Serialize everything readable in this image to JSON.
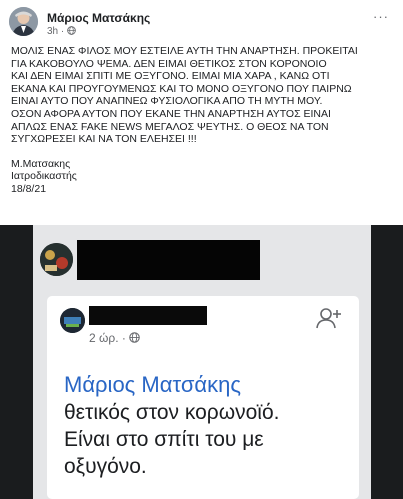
{
  "post": {
    "author": "Μάριος Ματσάκης",
    "time": "3h",
    "privacy_icon": "globe-icon",
    "menu_label": "···",
    "body_lines": [
      "ΜΟΛΙΣ ΕΝΑΣ ΦΙΛΟΣ ΜΟΥ ΕΣΤΕΙΛΕ ΑΥΤΗ ΤΗΝ ΑΝΑΡΤΗΣΗ.  ΠΡΟΚΕΙΤΑΙ",
      "ΓΙΑ ΚΑΚΟΒΟΥΛΟ ΨΕΜΑ. ΔΕΝ ΕΙΜΑΙ ΘΕΤΙΚΟΣ ΣΤΟΝ ΚΟΡΟΝΟΙΟ",
      "ΚΑΙ ΔΕΝ ΕΙΜΑΙ ΣΠΙΤΙ ΜΕ ΟΞΥΓΟΝΟ.  ΕΙΜΑΙ ΜΙΑ ΧΑΡΑ , ΚΑΝΩ ΟΤΙ",
      "ΕΚΑΝΑ ΚΑΙ ΠΡΟΥΓΟΥΜΕΝΩΣ ΚΑΙ ΤΟ ΜΟΝΟ ΟΞΥΓΟΝΟ ΠΟΥ ΠΑΙΡΝΩ",
      "ΕΙΝΑΙ ΑΥΤΟ ΠΟΥ ΑΝΑΠΝΕΩ ΦΥΣΙΟΛΟΓΙΚΑ ΑΠΟ ΤΗ ΜΥΤΗ ΜΟΥ.",
      "ΟΣΟΝ ΑΦΟΡΑ ΑΥΤΟΝ ΠΟΥ ΕΚΑΝΕ ΤΗΝ ΑΝΑΡΤΗΣΗ ΑΥΤΟΣ ΕΙΝΑΙ",
      "ΑΠΛΩΣ ΕΝΑΣ FAKE NEWS ΜΕΓΑΛΟΣ ΨΕΥΤΗΣ. Ο ΘΕΟΣ ΝΑ ΤΟΝ",
      "ΣΥΓΧΩΡΕΣΕΙ ΚΑΙ ΝΑ ΤΟΝ ΕΛΕΗΣΕΙ !!!"
    ],
    "signature": "Μ.Ματσακης",
    "title": "Ιατροδικαστής",
    "date": "18/8/21"
  },
  "shared_image": {
    "card_time": "2 ώρ. ·",
    "card_time_icon": "globe-icon",
    "add_friend_icon": "add-friend-icon",
    "name": "Μάριος Ματσάκης",
    "text_lines": [
      "θετικός στον κορωνοϊό.",
      "Είναι στο σπίτι του με",
      "οξυγόνο."
    ]
  },
  "colors": {
    "link_blue": "#2966c5",
    "meta_gray": "#65676b",
    "redaction": "#050505"
  }
}
